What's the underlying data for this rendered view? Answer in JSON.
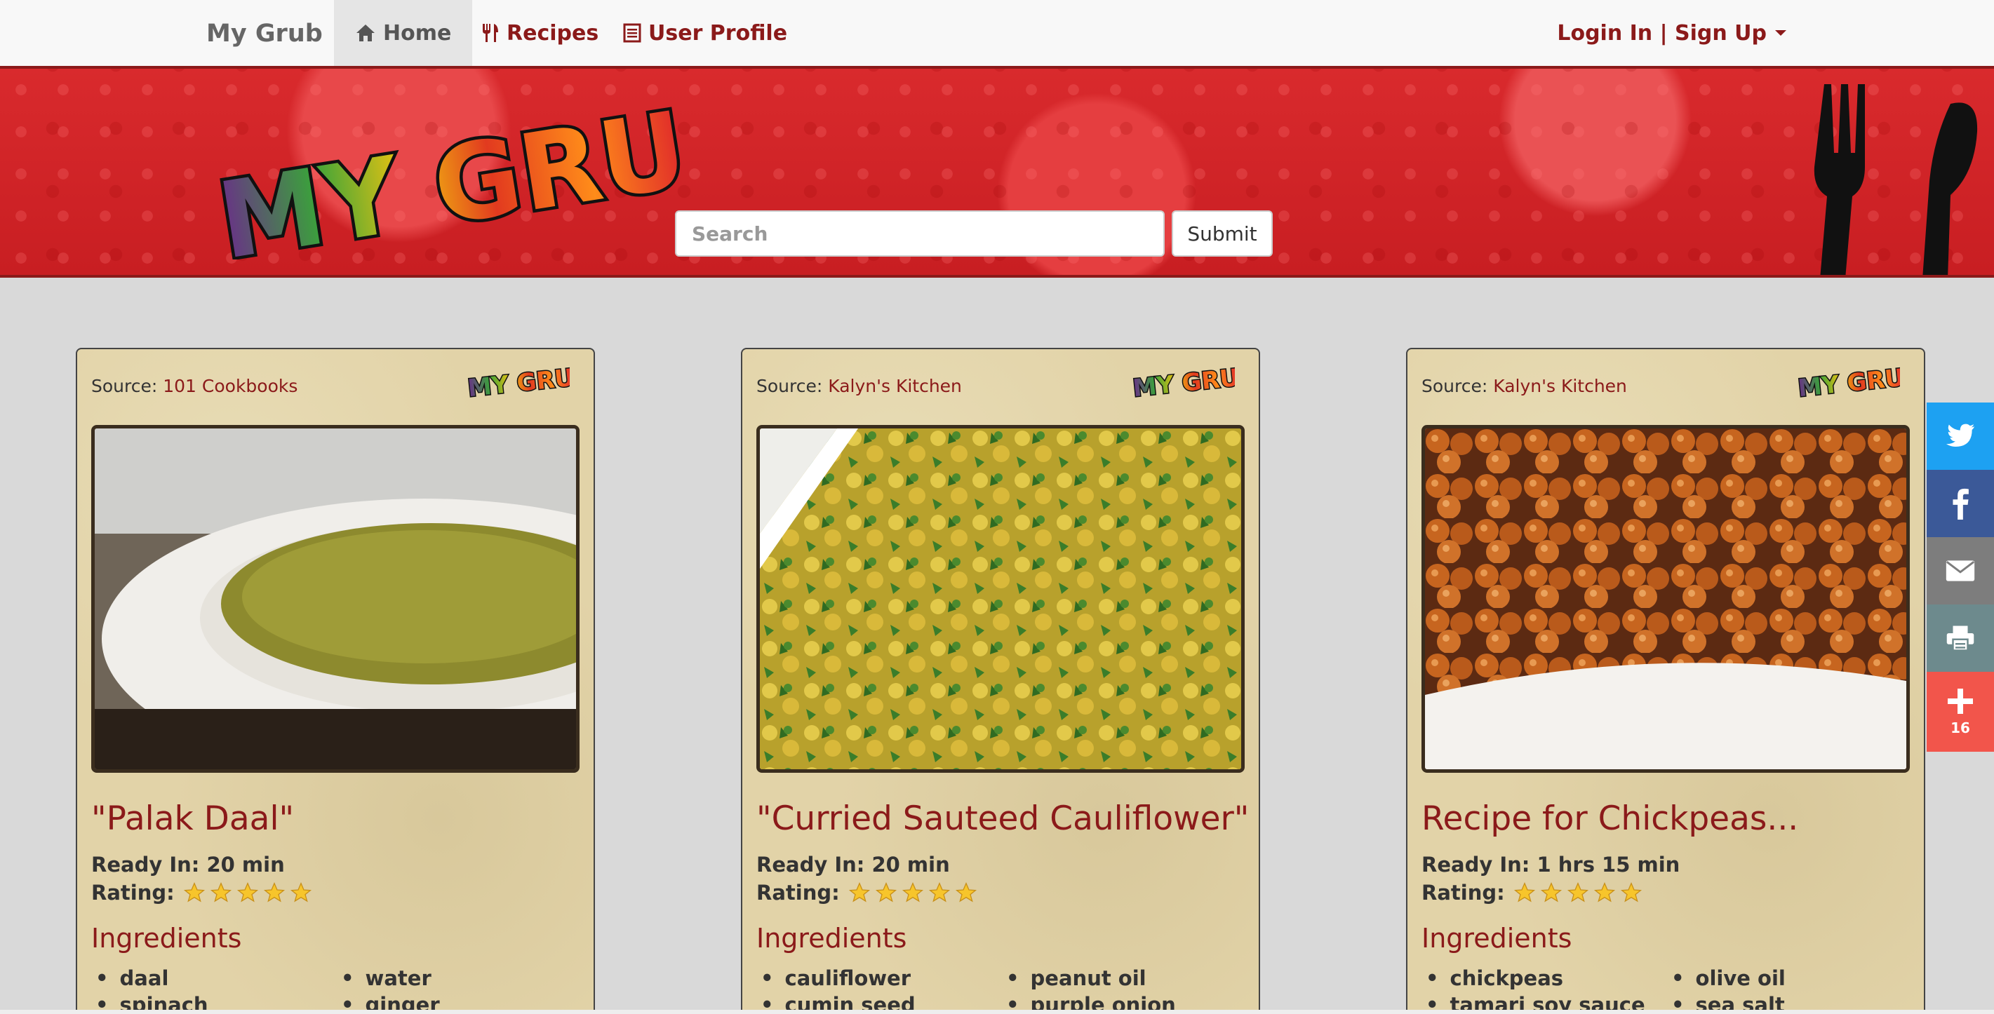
{
  "nav": {
    "brand": "My Grub",
    "home": "Home",
    "recipes": "Recipes",
    "profile": "User Profile",
    "login": "Login In | Sign Up"
  },
  "banner": {
    "logo_text": "MY GRUB",
    "search_placeholder": "Search",
    "submit": "Submit"
  },
  "labels": {
    "source": "Source: ",
    "ready": "Ready In: ",
    "rating": "Rating:",
    "ingredients": "Ingredients"
  },
  "cards": [
    {
      "source": "101 Cookbooks",
      "title": "\"Palak Daal\"",
      "ready": "20 min",
      "rating": 5,
      "ingredients": [
        "daal",
        "water",
        "spinach",
        "ginger"
      ]
    },
    {
      "source": "Kalyn's Kitchen",
      "title": "\"Curried Sauteed Cauliflower\"",
      "ready": "20 min",
      "rating": 5,
      "ingredients": [
        "cauliflower",
        "peanut oil",
        "cumin seed",
        "purple onion"
      ]
    },
    {
      "source": "Kalyn's Kitchen",
      "title": "Recipe for Chickpeas...",
      "ready": "1 hrs 15 min",
      "rating": 5,
      "ingredients": [
        "chickpeas",
        "olive oil",
        "tamari soy sauce",
        "sea salt"
      ]
    }
  ],
  "share": {
    "count": "16",
    "colors": {
      "twitter": "#1da1f2",
      "facebook": "#3b5998",
      "email": "#7d7d7d",
      "print": "#6d8a8d",
      "more": "#f2554b"
    }
  }
}
